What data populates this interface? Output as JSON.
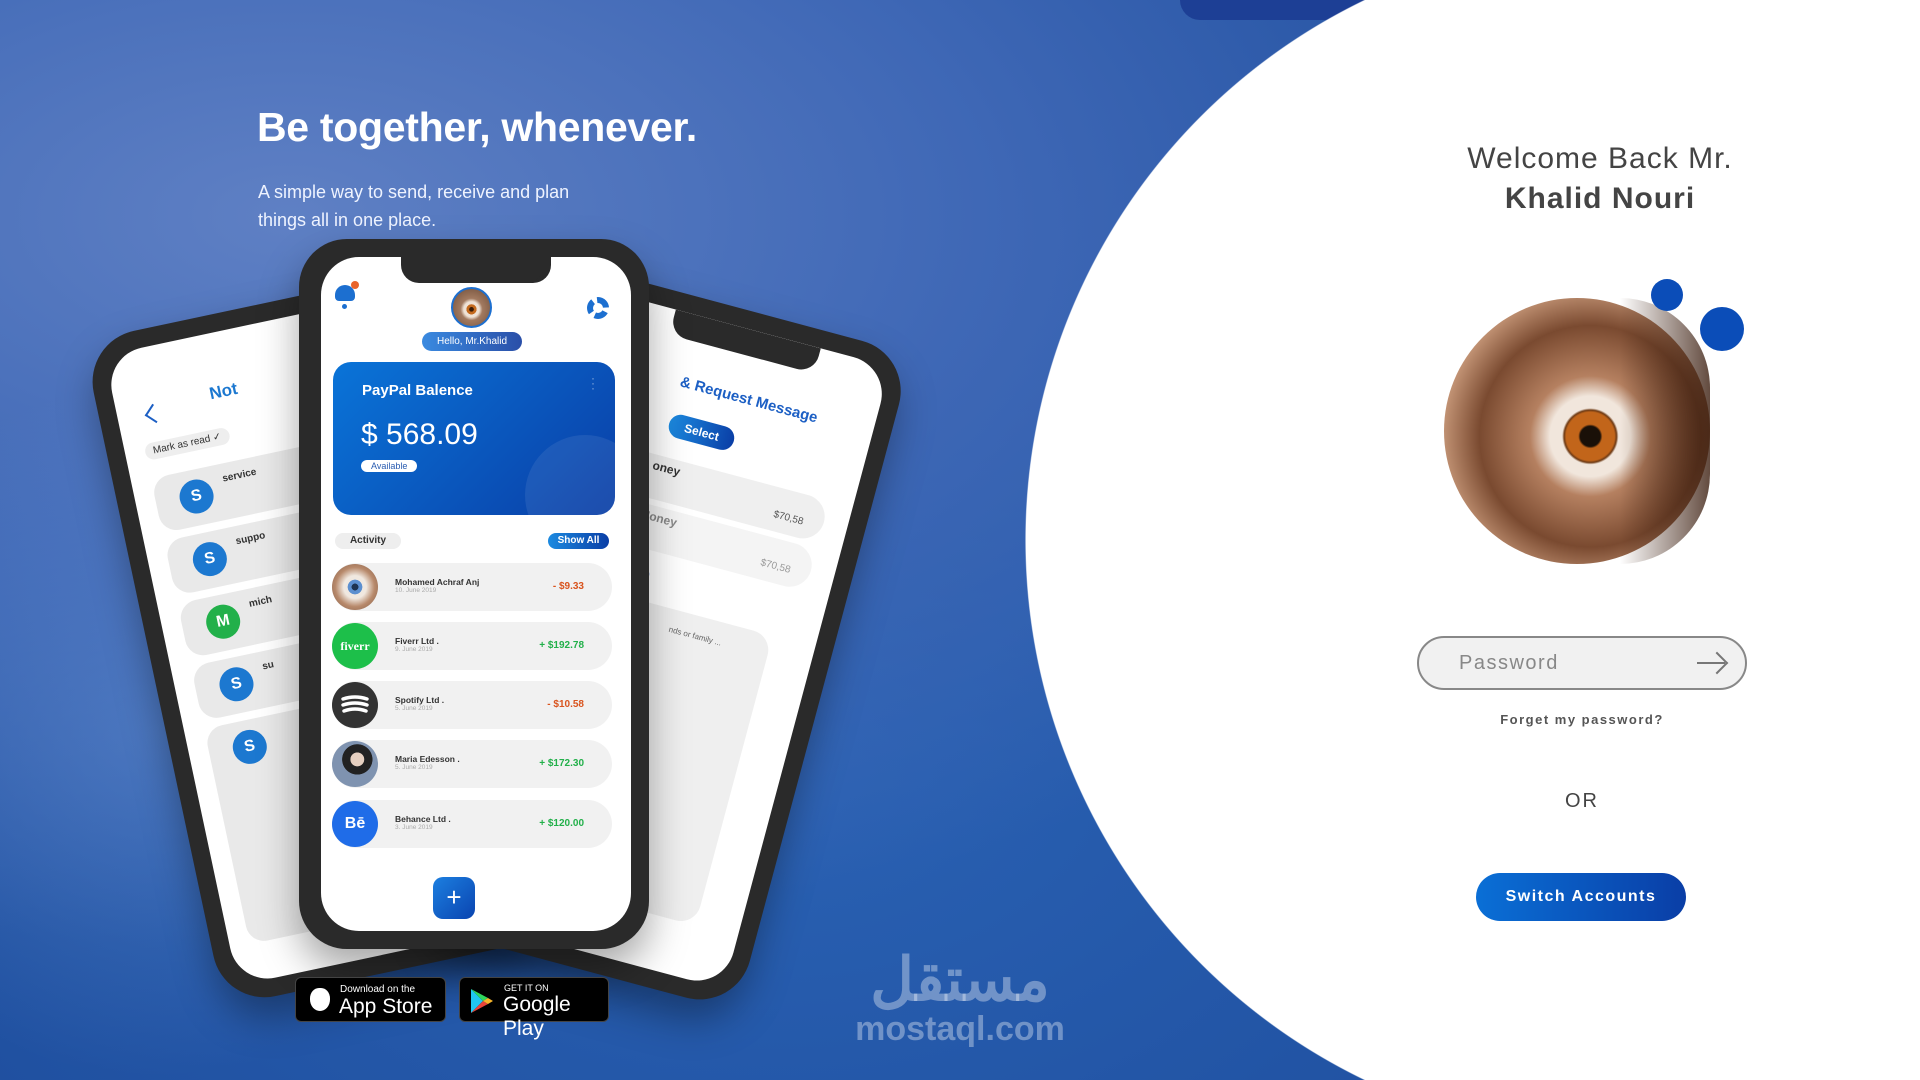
{
  "hero": {
    "title": "Be together, whenever.",
    "subtitle": "A simple way to send, receive and plan things all in one place."
  },
  "login": {
    "welcome": "Welcome Back Mr.",
    "name": "Khalid Nouri",
    "password_placeholder": "Password",
    "forgot": "Forget my password?",
    "or": "OR",
    "switch": "Switch Accounts"
  },
  "colors": {
    "brand": "#0a4fb8",
    "negative": "#d9541e",
    "positive": "#22b04a"
  },
  "main_phone": {
    "greeting": "Hello, Mr.Khalid",
    "card": {
      "title": "PayPal Balence",
      "amount": "$ 568.09",
      "badge": "Available"
    },
    "activity_label": "Activity",
    "show_all": "Show All",
    "transactions": [
      {
        "name": "Mohamed Achraf Anj",
        "date": "10. June 2019",
        "amount": "- $9.33",
        "type": "neg",
        "icon": "eye-photo"
      },
      {
        "name": "Fiverr Ltd .",
        "date": "9. June 2019",
        "amount": "+ $192.78",
        "type": "pos",
        "icon": "fiverr",
        "logo": "fiverr"
      },
      {
        "name": "Spotify Ltd .",
        "date": "5. June 2019",
        "amount": "- $10.58",
        "type": "neg",
        "icon": "spotify"
      },
      {
        "name": "Maria Edesson .",
        "date": "5. June 2019",
        "amount": "+ $172.30",
        "type": "pos",
        "icon": "person-photo"
      },
      {
        "name": "Behance Ltd .",
        "date": "3. June 2019",
        "amount": "+ $120.00",
        "type": "pos",
        "icon": "behance",
        "logo": "Bē"
      }
    ],
    "add": "+"
  },
  "left_phone": {
    "title": "Not",
    "mark_read": "Mark as read ✓",
    "items": [
      {
        "initial": "S",
        "name": "service"
      },
      {
        "initial": "S",
        "name": "suppo"
      },
      {
        "initial": "M",
        "name": "mich"
      },
      {
        "initial": "S",
        "name": "su"
      },
      {
        "initial": "S",
        "name": ""
      }
    ]
  },
  "right_phone": {
    "title": "& Request Message",
    "select": "Select",
    "rows": [
      {
        "label": "oney",
        "amount": "$70,58"
      },
      {
        "label": "Money",
        "amount": "$70,58"
      }
    ],
    "message": "ssage",
    "hint": "nds or family ..."
  },
  "stores": {
    "apple_top": "Download on the",
    "apple_main": "App Store",
    "google_top": "GET IT ON",
    "google_main": "Google Play"
  },
  "watermark": {
    "arabic": "مستقل",
    "latin": "mostaql.com"
  }
}
